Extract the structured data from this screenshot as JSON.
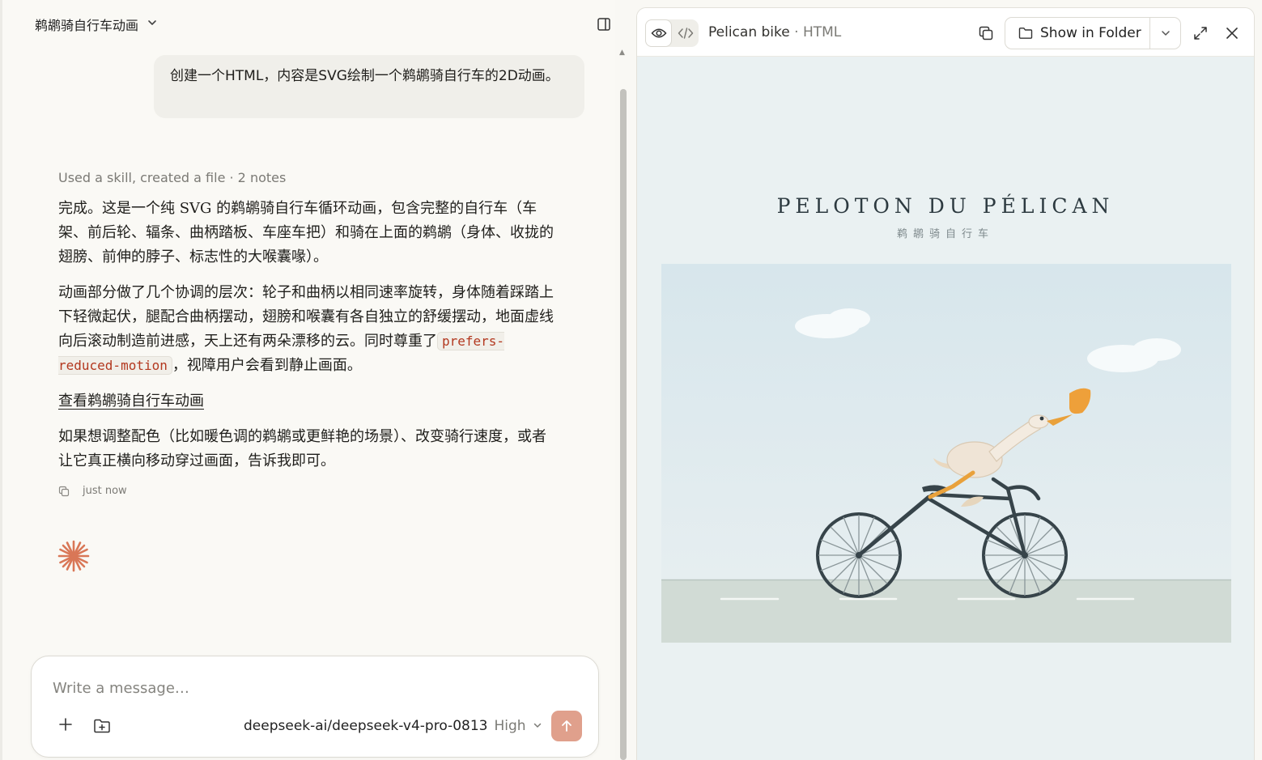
{
  "chat": {
    "title": "鹈鹕骑自行车动画",
    "user_message": "创建一个HTML，内容是SVG绘制一个鹈鹕骑自行车的2D动画。",
    "assistant": {
      "skill_note": "Used a skill, created a file · 2 notes",
      "para1": "完成。这是一个纯 SVG 的鹈鹕骑自行车循环动画，包含完整的自行车（车架、前后轮、辐条、曲柄踏板、车座车把）和骑在上面的鹈鹕（身体、收拢的翅膀、前伸的脖子、标志性的大喉囊喙）。",
      "para2_before": "动画部分做了几个协调的层次：轮子和曲柄以相同速率旋转，身体随着踩踏上下轻微起伏，腿配合曲柄摆动，翅膀和喉囊有各自独立的舒缓摆动，地面虚线向后滚动制造前进感，天上还有两朵漂移的云。同时尊重了",
      "para2_code": "prefers-reduced-motion",
      "para2_after": "，视障用户会看到静止画面。",
      "link_text": "查看鹈鹕骑自行车动画",
      "para3": "如果想调整配色（比如暖色调的鹈鹕或更鲜艳的场景）、改变骑行速度，或者让它真正横向移动穿过画面，告诉我即可。",
      "timestamp": "just now"
    }
  },
  "composer": {
    "placeholder": "Write a message…",
    "model": "deepseek-ai/deepseek-v4-pro-0813",
    "effort": "High"
  },
  "artifact": {
    "title": "Pelican bike",
    "separator": " · ",
    "type": "HTML",
    "show_in_folder": "Show in Folder",
    "scene_title": "PELOTON DU PÉLICAN",
    "scene_subtitle": "鹈鹕骑自行车"
  },
  "colors": {
    "accent": "#d97757",
    "send_button": "#e0a08c",
    "sky": "#dce9ee",
    "ground": "#d3dcd6",
    "bike_frame": "#37444a",
    "pelican_body": "#efe4d6",
    "pelican_beak": "#e9a13b"
  },
  "icons": {
    "sidebar_toggle": "sidebar-toggle-icon",
    "copy": "copy-icon",
    "spark": "spark-icon",
    "eye": "eye-icon",
    "code": "code-icon",
    "folder": "folder-icon",
    "expand": "expand-icon",
    "close": "close-icon"
  }
}
